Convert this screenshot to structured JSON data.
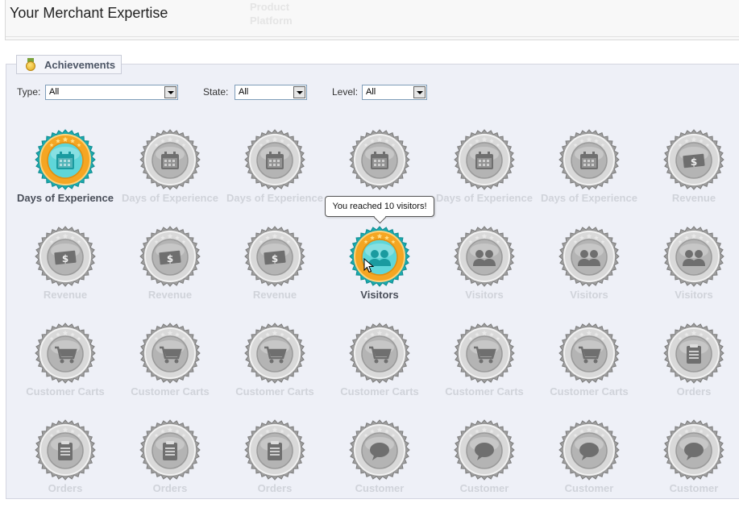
{
  "header": {
    "title": "Your Merchant Expertise",
    "ghost_text": "Product\nPlatform"
  },
  "achievements": {
    "legend": "Achievements",
    "filters": {
      "type_label": "Type:",
      "type_value": "All",
      "state_label": "State:",
      "state_value": "All",
      "level_label": "Level:",
      "level_value": "All"
    },
    "tooltip": "You reached 10 visitors!",
    "badges": [
      {
        "label": "Days of Experience",
        "icon": "calendar-icon",
        "active": true
      },
      {
        "label": "Days of Experience",
        "icon": "calendar-icon",
        "active": false
      },
      {
        "label": "Days of Experience",
        "icon": "calendar-icon",
        "active": false
      },
      {
        "label": "",
        "icon": "calendar-icon",
        "active": false
      },
      {
        "label": "Days of Experience",
        "icon": "calendar-icon",
        "active": false
      },
      {
        "label": "Days of Experience",
        "icon": "calendar-icon",
        "active": false
      },
      {
        "label": "Revenue",
        "icon": "money-icon",
        "active": false
      },
      {
        "label": "Revenue",
        "icon": "money-icon",
        "active": false
      },
      {
        "label": "Revenue",
        "icon": "money-icon",
        "active": false
      },
      {
        "label": "Revenue",
        "icon": "money-icon",
        "active": false
      },
      {
        "label": "Visitors",
        "icon": "users-icon",
        "active": true
      },
      {
        "label": "Visitors",
        "icon": "users-icon",
        "active": false
      },
      {
        "label": "Visitors",
        "icon": "users-icon",
        "active": false
      },
      {
        "label": "Visitors",
        "icon": "users-icon",
        "active": false
      },
      {
        "label": "Customer Carts",
        "icon": "cart-icon",
        "active": false
      },
      {
        "label": "Customer Carts",
        "icon": "cart-icon",
        "active": false
      },
      {
        "label": "Customer Carts",
        "icon": "cart-icon",
        "active": false
      },
      {
        "label": "Customer Carts",
        "icon": "cart-icon",
        "active": false
      },
      {
        "label": "Customer Carts",
        "icon": "cart-icon",
        "active": false
      },
      {
        "label": "Customer Carts",
        "icon": "cart-icon",
        "active": false
      },
      {
        "label": "Orders",
        "icon": "order-icon",
        "active": false
      },
      {
        "label": "Orders",
        "icon": "order-icon",
        "active": false
      },
      {
        "label": "Orders",
        "icon": "order-icon",
        "active": false
      },
      {
        "label": "Orders",
        "icon": "order-icon",
        "active": false
      },
      {
        "label": "Customer",
        "icon": "chat-icon",
        "active": false
      },
      {
        "label": "Customer",
        "icon": "chat-icon",
        "active": false
      },
      {
        "label": "Customer",
        "icon": "chat-icon",
        "active": false
      },
      {
        "label": "Customer",
        "icon": "chat-icon",
        "active": false
      }
    ]
  },
  "colors": {
    "active_teal": "#1fb3b8",
    "active_gold": "#f5a623",
    "inactive_gray": "#9a9a9a",
    "panel_bg": "#eef0f7"
  }
}
